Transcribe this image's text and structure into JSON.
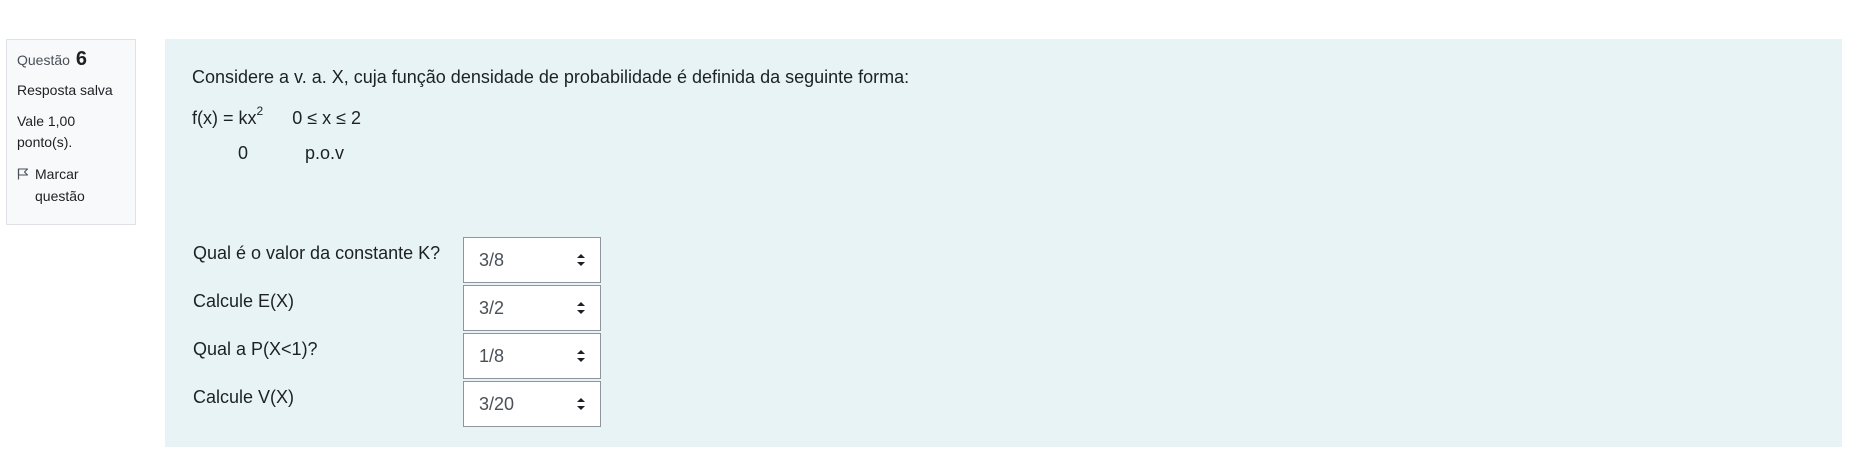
{
  "info": {
    "question_label": "Questão",
    "question_number": "6",
    "state": "Resposta salva",
    "grade": "Vale 1,00 ponto(s).",
    "flag_label": "Marcar questão"
  },
  "question": {
    "text": "Considere a v. a. X, cuja função densidade de probabilidade é definida da seguinte forma:",
    "fx_lhs": "f(x) = kx",
    "fx_exp": "2",
    "fx_range": "0 ≤ x ≤ 2",
    "otherwise_value": "0",
    "otherwise_label": "p.o.v"
  },
  "subquestions": [
    {
      "prompt": "Qual é o  valor da constante K?",
      "selected": "3/8"
    },
    {
      "prompt": "Calcule E(X)",
      "selected": "3/2"
    },
    {
      "prompt": "Qual a P(X<1)?",
      "selected": "1/8"
    },
    {
      "prompt": "Calcule V(X)",
      "selected": "3/20"
    }
  ]
}
